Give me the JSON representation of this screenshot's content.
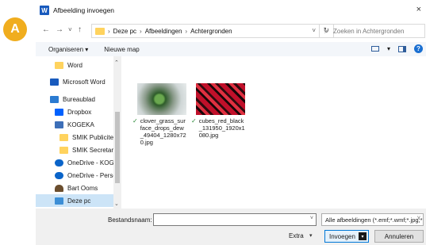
{
  "badge": {
    "letter": "A"
  },
  "titlebar": {
    "app_icon": "word-app-icon",
    "title": "Afbeelding invoegen",
    "close": "×"
  },
  "nav": {
    "back": "←",
    "forward": "→",
    "recent": "˅",
    "up": "↑"
  },
  "addressbar": {
    "crumbs": [
      "Deze pc",
      "Afbeeldingen",
      "Achtergronden"
    ],
    "separator": "›",
    "dropdown": "˅",
    "refresh": "↻"
  },
  "search": {
    "icon": "⌕",
    "placeholder": "Zoeken in Achtergronden"
  },
  "commandbar": {
    "organize": "Organiseren ▾",
    "new_folder": "Nieuwe map",
    "view_dd": "▾",
    "help": "?"
  },
  "sidebar": {
    "scroll_up": "⌃",
    "scroll_down": "⌄",
    "items": [
      {
        "label": "Word",
        "icon": "folder-icon",
        "color": "#ffd35e"
      },
      {
        "label": "Microsoft Word",
        "icon": "word-icon",
        "color": "#185abd"
      },
      {
        "label": "Bureaublad",
        "icon": "desktop-icon",
        "color": "#2b7bd1"
      },
      {
        "label": "Dropbox",
        "icon": "dropbox-icon",
        "color": "#0061fe"
      },
      {
        "label": "KOGEKA",
        "icon": "building-icon",
        "color": "#3d6fb8"
      },
      {
        "label": "SMIK Publiciteit",
        "icon": "folder-icon",
        "color": "#ffd35e"
      },
      {
        "label": "SMIK Secretariaat",
        "icon": "folder-icon",
        "color": "#ffd35e"
      },
      {
        "label": "OneDrive - KOGEKA",
        "icon": "cloud-icon",
        "color": "#0a64c9"
      },
      {
        "label": "OneDrive - Persoonlijk",
        "icon": "cloud-icon",
        "color": "#0a64c9"
      },
      {
        "label": "Bart Ooms",
        "icon": "user-icon",
        "color": "#6b4e2e"
      },
      {
        "label": "Deze pc",
        "icon": "computer-icon",
        "color": "#3d8fd6"
      }
    ]
  },
  "files": [
    {
      "name": "clover_grass_surface_drops_dew_49404_1280x720.jpg",
      "status": "✓",
      "thumb": "clover"
    },
    {
      "name": "cubes_red_black_131950_1920x1080.jpg",
      "status": "✓",
      "thumb": "cubes"
    }
  ],
  "footer": {
    "filename_label": "Bestandsnaam:",
    "filename_value": "",
    "filename_dd": "˅",
    "filter": "Alle afbeeldingen (*.emf;*.wmf;*.jpg;*.jpeg;*.jfif;*.jpe;*.png;*.bmp;*.dib;*.rle;*.gif;*.emz;*.wmz;*.tif;*.tiff;*.svg;*.ico)",
    "filter_dd": "˅",
    "extra": "Extra",
    "extra_dd": "▾",
    "open": "Invoegen",
    "open_split": "▾",
    "cancel": "Annuleren"
  }
}
